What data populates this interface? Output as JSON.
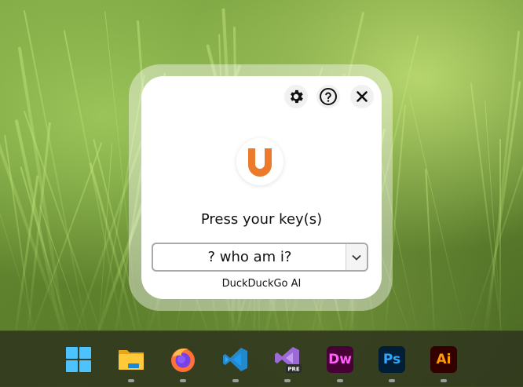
{
  "dialog": {
    "logo_letter": "U",
    "title": "Press your key(s)",
    "key_value": "? who am i?",
    "subtitle": "DuckDuckGo AI"
  },
  "taskbar": {
    "apps": [
      {
        "name": "Start",
        "label": ""
      },
      {
        "name": "File Explorer",
        "label": ""
      },
      {
        "name": "Firefox",
        "label": ""
      },
      {
        "name": "VS Code",
        "label": ""
      },
      {
        "name": "Visual Studio Preview",
        "label": "PRE"
      },
      {
        "name": "Dreamweaver",
        "label": "Dw"
      },
      {
        "name": "Photoshop",
        "label": "Ps"
      },
      {
        "name": "Illustrator",
        "label": "Ai"
      }
    ]
  },
  "colors": {
    "logo_orange": "#ec7a2d",
    "dw": "#ff61f6",
    "ps": "#31a8ff",
    "ai": "#ff9a00"
  }
}
